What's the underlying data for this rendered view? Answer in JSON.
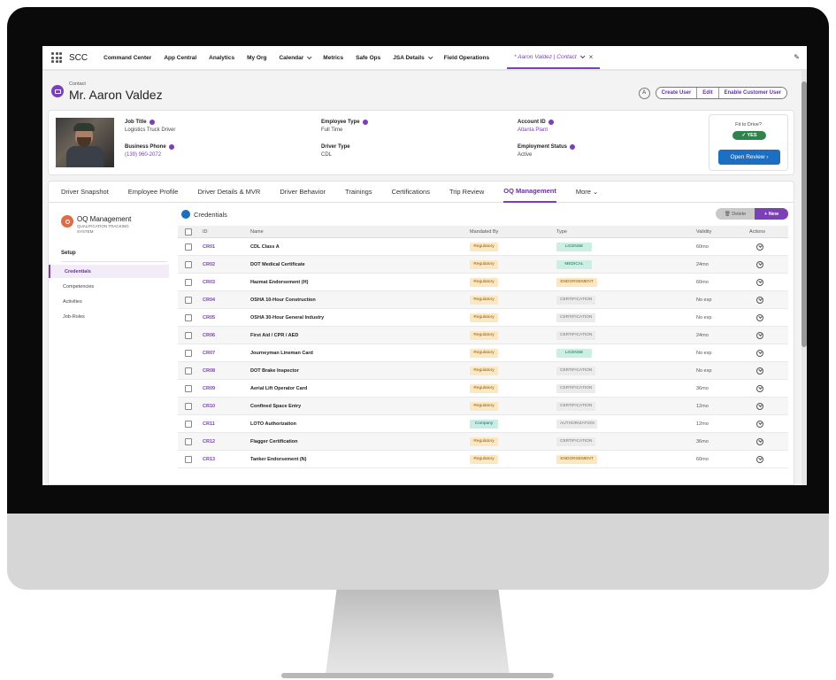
{
  "nav": {
    "app_name": "SCC",
    "items": [
      {
        "label": "Command Center",
        "dropdown": false
      },
      {
        "label": "App Central",
        "dropdown": false
      },
      {
        "label": "Analytics",
        "dropdown": false
      },
      {
        "label": "My Org",
        "dropdown": false
      },
      {
        "label": "Calendar",
        "dropdown": true
      },
      {
        "label": "Metrics",
        "dropdown": false
      },
      {
        "label": "Safe Ops",
        "dropdown": false
      },
      {
        "label": "JSA Details",
        "dropdown": true
      },
      {
        "label": "Field Operations",
        "dropdown": false
      }
    ],
    "active_tab": "* Aaron Valdez | Contact",
    "close": "×"
  },
  "header": {
    "object_label": "Contact",
    "name": "Mr. Aaron Valdez",
    "round_button": "A",
    "buttons": [
      "Create User",
      "Edit",
      "Enable Customer User"
    ]
  },
  "profile": {
    "job_title_label": "Job Title",
    "job_title": "Logistics Truck Driver",
    "phone_label": "Business Phone",
    "phone": "(139) 960-2072",
    "emp_type_label": "Employee Type",
    "emp_type": "Full Time",
    "driver_type_label": "Driver Type",
    "driver_type": "CDL",
    "account_label": "Account ID",
    "account": "Atlanta Plant",
    "status_label": "Employment Status",
    "status": "Active",
    "fit_label": "Fit to Drive?",
    "fit_value": "✓ YES",
    "review_button": "Open Review ›"
  },
  "tabs": [
    "Driver Snapshot",
    "Employee Profile",
    "Driver Details & MVR",
    "Driver Behavior",
    "Trainings",
    "Certifications",
    "Trip Review",
    "OQ Management",
    "More ⌄"
  ],
  "active_tab_index": 7,
  "leftnav": {
    "title": "OQ Management",
    "subtitle": "QUALIFICATION TRACKING SYSTEM",
    "section": "Setup",
    "items": [
      "Credentials",
      "Competencies",
      "Activities",
      "Job-Roles"
    ],
    "active_index": 0
  },
  "credentials": {
    "title": "Credentials",
    "delete_label": "🗑 Delete",
    "new_label": "+ New",
    "columns": [
      "ID",
      "Name",
      "Mandated By",
      "Type",
      "Validity",
      "Actions"
    ],
    "rows": [
      {
        "id": "CR01",
        "name": "CDL Class A",
        "mandated": "Regulatory",
        "type": "LICENSE",
        "validity": "60mo"
      },
      {
        "id": "CR02",
        "name": "DOT Medical Certificate",
        "mandated": "Regulatory",
        "type": "MEDICAL",
        "validity": "24mo"
      },
      {
        "id": "CR03",
        "name": "Hazmat Endorsement (H)",
        "mandated": "Regulatory",
        "type": "ENDORSEMENT",
        "validity": "60mo"
      },
      {
        "id": "CR04",
        "name": "OSHA 10-Hour Construction",
        "mandated": "Regulatory",
        "type": "CERTIFICATION",
        "validity": "No exp"
      },
      {
        "id": "CR05",
        "name": "OSHA 30-Hour General Industry",
        "mandated": "Regulatory",
        "type": "CERTIFICATION",
        "validity": "No exp"
      },
      {
        "id": "CR06",
        "name": "First Aid / CPR / AED",
        "mandated": "Regulatory",
        "type": "CERTIFICATION",
        "validity": "24mo"
      },
      {
        "id": "CR07",
        "name": "Journeyman Lineman Card",
        "mandated": "Regulatory",
        "type": "LICENSE",
        "validity": "No exp"
      },
      {
        "id": "CR08",
        "name": "DOT Brake Inspector",
        "mandated": "Regulatory",
        "type": "CERTIFICATION",
        "validity": "No exp"
      },
      {
        "id": "CR09",
        "name": "Aerial Lift Operator Card",
        "mandated": "Regulatory",
        "type": "CERTIFICATION",
        "validity": "36mo"
      },
      {
        "id": "CR10",
        "name": "Confined Space Entry",
        "mandated": "Regulatory",
        "type": "CERTIFICATION",
        "validity": "12mo"
      },
      {
        "id": "CR11",
        "name": "LOTO Authorization",
        "mandated": "Company",
        "type": "AUTHORIZATION",
        "validity": "12mo"
      },
      {
        "id": "CR12",
        "name": "Flagger Certification",
        "mandated": "Regulatory",
        "type": "CERTIFICATION",
        "validity": "36mo"
      },
      {
        "id": "CR13",
        "name": "Tanker Endorsement (N)",
        "mandated": "Regulatory",
        "type": "ENDORSEMENT",
        "validity": "60mo"
      }
    ]
  },
  "colors": {
    "accent": "#7b3fb6",
    "primary_button": "#1b6ec2",
    "fit_green": "#2e844a"
  }
}
